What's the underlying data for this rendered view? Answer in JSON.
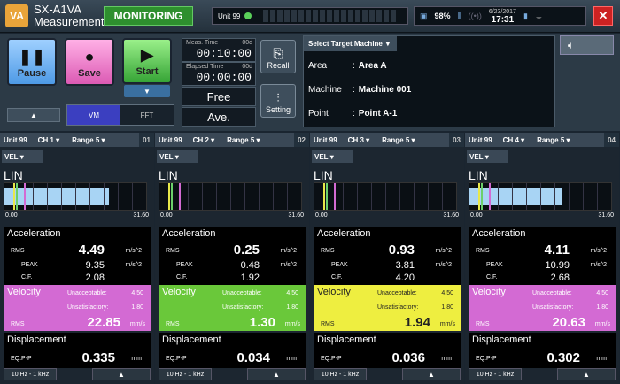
{
  "header": {
    "logo": "VA",
    "app_title": "SX-A1VA",
    "app_subtitle": "Measurement",
    "monitoring_label": "MONITORING",
    "unit_label": "Unit 99",
    "battery_pct": "98%",
    "date": "6/23/2017",
    "time": "17:31",
    "close_glyph": "✕"
  },
  "controls": {
    "pause_label": "Pause",
    "save_label": "Save",
    "start_label": "Start",
    "up_glyph": "▲",
    "down_glyph": "▼",
    "vm_label": "VM",
    "fft_label": "FFT",
    "meas_time_label": "Meas. Time",
    "meas_time_days": "00d",
    "meas_time": "00:10:00",
    "elapsed_time_label": "Elapsed Time",
    "elapsed_time_days": "00d",
    "elapsed_time": "00:00:00",
    "mode1": "Free",
    "mode2": "Ave.",
    "recall_label": "Recall",
    "setting_label": "Setting"
  },
  "target": {
    "header": "Select Target Machine",
    "area_label": "Area",
    "area_value": "Area A",
    "machine_label": "Machine",
    "machine_value": "Machine 001",
    "point_label": "Point",
    "point_value": "Point A-1",
    "sep": ":"
  },
  "channels": [
    {
      "unit": "Unit 99",
      "ch": "CH 1",
      "range": "Range 5",
      "num": "01",
      "mode": "VEL",
      "lin": "LIN",
      "scale_min": "0.00",
      "scale_max": "31.60",
      "level": 0.74,
      "acc_title": "Acceleration",
      "rms_label": "RMS",
      "rms": "4.49",
      "unit_acc": "m/s^2",
      "peak_label": "PEAK",
      "peak": "9.35",
      "cf_label": "C.F.",
      "cf": "2.08",
      "vel_title": "Velocity",
      "unacc_label": "Unacceptable:",
      "unacc": "4.50",
      "unsat_label": "Unsatisfactory:",
      "unsat": "1.80",
      "vel_rms_label": "RMS",
      "vel_rms": "22.85",
      "unit_vel": "mm/s",
      "vel_color": "#d36ad3",
      "disp_title": "Displacement",
      "eq_label": "EQ.P-P",
      "eq": "0.335",
      "unit_disp": "mm",
      "filter": "10 Hz - 1 kHz"
    },
    {
      "unit": "Unit 99",
      "ch": "CH 2",
      "range": "Range 5",
      "num": "02",
      "mode": "VEL",
      "lin": "LIN",
      "scale_min": "0.00",
      "scale_max": "31.60",
      "level": 0.0,
      "acc_title": "Acceleration",
      "rms_label": "RMS",
      "rms": "0.25",
      "unit_acc": "m/s^2",
      "peak_label": "PEAK",
      "peak": "0.48",
      "cf_label": "C.F.",
      "cf": "1.92",
      "vel_title": "Velocity",
      "unacc_label": "Unacceptable:",
      "unacc": "4.50",
      "unsat_label": "Unsatisfactory:",
      "unsat": "1.80",
      "vel_rms_label": "RMS",
      "vel_rms": "1.30",
      "unit_vel": "mm/s",
      "vel_color": "#6ac83a",
      "disp_title": "Displacement",
      "eq_label": "EQ.P-P",
      "eq": "0.034",
      "unit_disp": "mm",
      "filter": "10 Hz - 1 kHz"
    },
    {
      "unit": "Unit 99",
      "ch": "CH 3",
      "range": "Range 5",
      "num": "03",
      "mode": "VEL",
      "lin": "LIN",
      "scale_min": "0.00",
      "scale_max": "31.60",
      "level": 0.0,
      "acc_title": "Acceleration",
      "rms_label": "RMS",
      "rms": "0.93",
      "unit_acc": "m/s^2",
      "peak_label": "PEAK",
      "peak": "3.81",
      "cf_label": "C.F.",
      "cf": "4.20",
      "vel_title": "Velocity",
      "unacc_label": "Unacceptable:",
      "unacc": "4.50",
      "unsat_label": "Unsatisfactory:",
      "unsat": "1.80",
      "vel_rms_label": "RMS",
      "vel_rms": "1.94",
      "unit_vel": "mm/s",
      "vel_color": "#eeee40",
      "disp_title": "Displacement",
      "eq_label": "EQ.P-P",
      "eq": "0.036",
      "unit_disp": "mm",
      "filter": "10 Hz - 1 kHz"
    },
    {
      "unit": "Unit 99",
      "ch": "CH 4",
      "range": "Range 5",
      "num": "04",
      "mode": "VEL",
      "lin": "LIN",
      "scale_min": "0.00",
      "scale_max": "31.60",
      "level": 0.65,
      "acc_title": "Acceleration",
      "rms_label": "RMS",
      "rms": "4.11",
      "unit_acc": "m/s^2",
      "peak_label": "PEAK",
      "peak": "10.99",
      "cf_label": "C.F.",
      "cf": "2.68",
      "vel_title": "Velocity",
      "unacc_label": "Unacceptable:",
      "unacc": "4.50",
      "unsat_label": "Unsatisfactory:",
      "unsat": "1.80",
      "vel_rms_label": "RMS",
      "vel_rms": "20.63",
      "unit_vel": "mm/s",
      "vel_color": "#d36ad3",
      "disp_title": "Displacement",
      "eq_label": "EQ.P-P",
      "eq": "0.302",
      "unit_disp": "mm",
      "filter": "10 Hz - 1 kHz"
    }
  ]
}
